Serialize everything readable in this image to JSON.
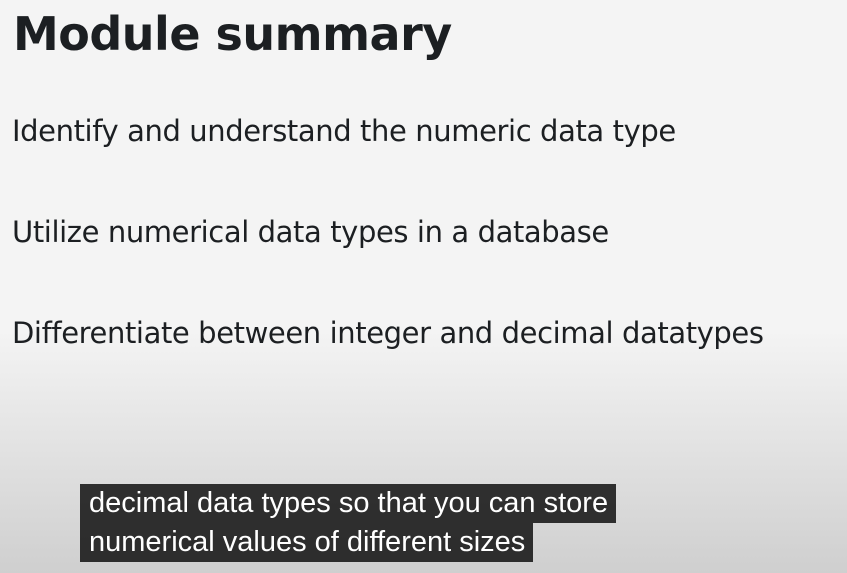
{
  "slide": {
    "title": "Module summary",
    "objectives": [
      "Identify and understand the numeric data type",
      "Utilize numerical data types in a database",
      "Differentiate between integer and decimal datatypes"
    ]
  },
  "captions": {
    "lines": [
      "decimal data types so that you can store",
      "numerical values of different sizes"
    ],
    "text_color": "#ffffff",
    "background_color": "#080808"
  },
  "colors": {
    "title_text": "#1c1f22",
    "slide_background": "#f4f4f4"
  }
}
